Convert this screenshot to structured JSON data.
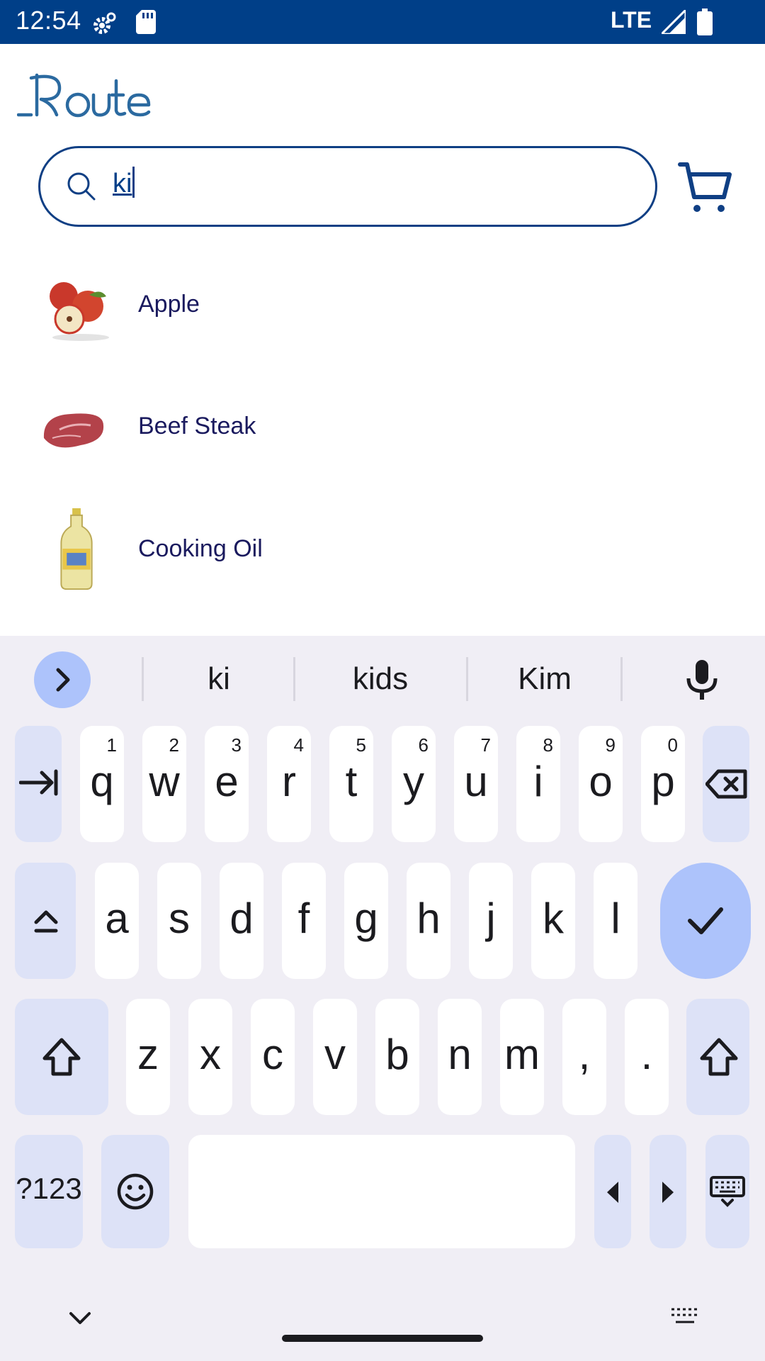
{
  "status_bar": {
    "time": "12:54",
    "network": "LTE",
    "icons": [
      "settings-icon",
      "sd-card-icon",
      "signal-icon",
      "battery-icon"
    ],
    "background": "#003f88"
  },
  "header": {
    "logo_text": "Route"
  },
  "search": {
    "value": "ki",
    "border_color": "#0f3f84"
  },
  "results": [
    {
      "label": "Apple",
      "image": "apple-image"
    },
    {
      "label": "Beef Steak",
      "image": "beef-steak-image"
    },
    {
      "label": "Cooking Oil",
      "image": "cooking-oil-image"
    }
  ],
  "keyboard": {
    "suggestions": [
      "ki",
      "kids",
      "Kim"
    ],
    "row1": [
      {
        "ch": "q",
        "num": "1"
      },
      {
        "ch": "w",
        "num": "2"
      },
      {
        "ch": "e",
        "num": "3"
      },
      {
        "ch": "r",
        "num": "4"
      },
      {
        "ch": "t",
        "num": "5"
      },
      {
        "ch": "y",
        "num": "6"
      },
      {
        "ch": "u",
        "num": "7"
      },
      {
        "ch": "i",
        "num": "8"
      },
      {
        "ch": "o",
        "num": "9"
      },
      {
        "ch": "p",
        "num": "0"
      }
    ],
    "row2": [
      "a",
      "s",
      "d",
      "f",
      "g",
      "h",
      "j",
      "k",
      "l"
    ],
    "row3": [
      "z",
      "x",
      "c",
      "v",
      "b",
      "n",
      "m",
      ",",
      "."
    ],
    "symbols_label": "?123",
    "accent": "#adc3fb"
  }
}
